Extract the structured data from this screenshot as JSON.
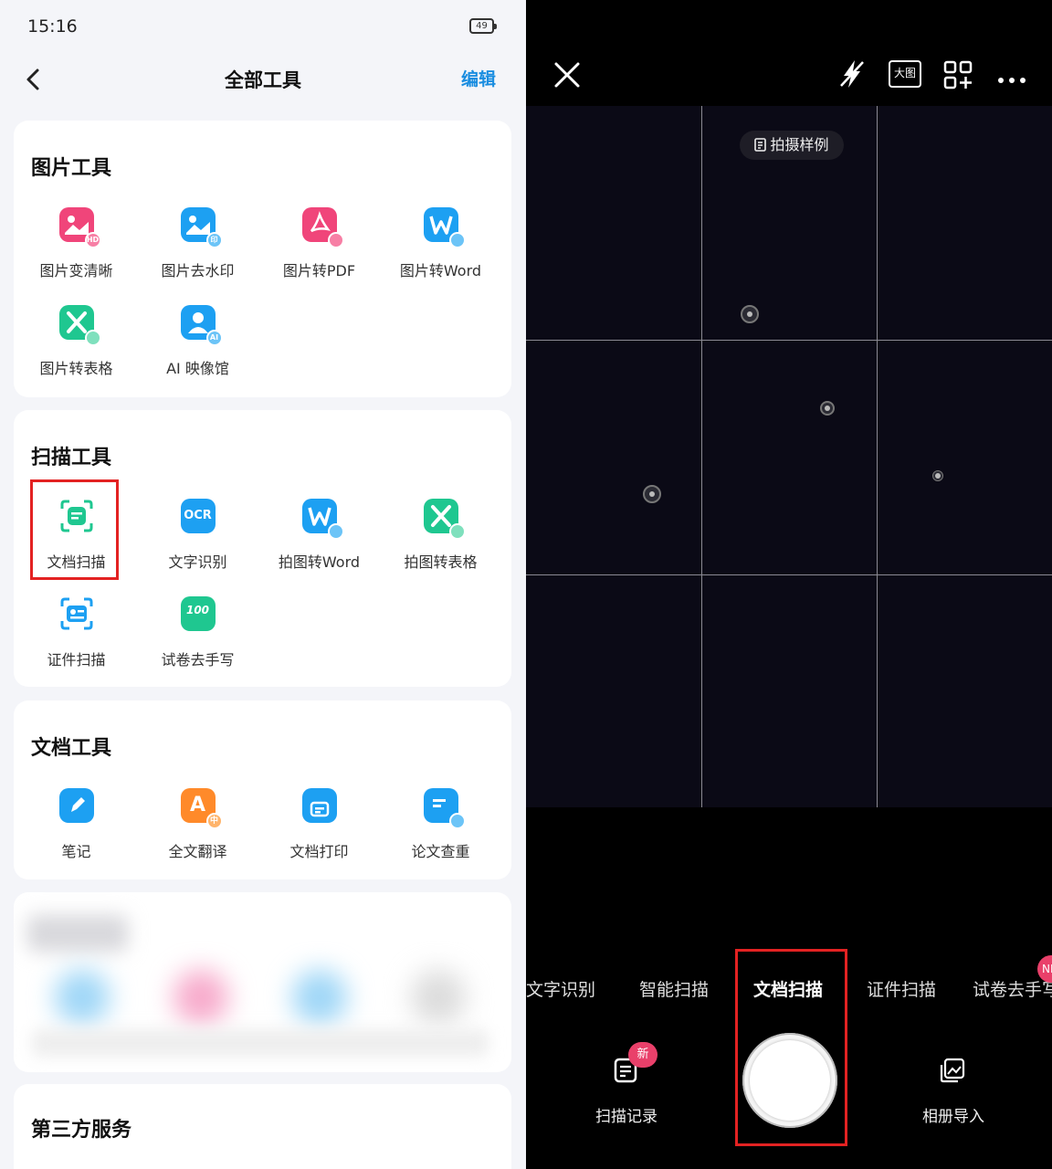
{
  "status_bar": {
    "time": "15:16",
    "battery": "49"
  },
  "nav": {
    "title": "全部工具",
    "edit": "编辑"
  },
  "sections": {
    "image_tools": {
      "title": "图片工具",
      "tools": [
        {
          "label": "图片变清晰",
          "icon": "image-hd-icon",
          "color": "#f0457a",
          "sub": "HD"
        },
        {
          "label": "图片去水印",
          "icon": "image-watermark-icon",
          "color": "#1da0f2",
          "sub": "印"
        },
        {
          "label": "图片转PDF",
          "icon": "image-pdf-icon",
          "color": "#f0457a",
          "sub": ""
        },
        {
          "label": "图片转Word",
          "icon": "image-word-icon",
          "color": "#1da0f2",
          "sub": ""
        },
        {
          "label": "图片转表格",
          "icon": "image-excel-icon",
          "color": "#1fc790",
          "sub": ""
        },
        {
          "label": "AI 映像馆",
          "icon": "ai-portrait-icon",
          "color": "#1da0f2",
          "sub": "AI"
        }
      ]
    },
    "scan_tools": {
      "title": "扫描工具",
      "tools": [
        {
          "label": "文档扫描",
          "icon": "document-scan-icon",
          "color": "#1fc790"
        },
        {
          "label": "文字识别",
          "icon": "ocr-icon",
          "color": "#1da0f2",
          "text": "OCR"
        },
        {
          "label": "拍图转Word",
          "icon": "photo-word-icon",
          "color": "#1da0f2"
        },
        {
          "label": "拍图转表格",
          "icon": "photo-excel-icon",
          "color": "#1fc790"
        },
        {
          "label": "证件扫描",
          "icon": "id-scan-icon",
          "color": "#1da0f2"
        },
        {
          "label": "试卷去手写",
          "icon": "exam-handwriting-icon",
          "color": "#1fc790",
          "text": "100"
        }
      ]
    },
    "doc_tools": {
      "title": "文档工具",
      "tools": [
        {
          "label": "笔记",
          "icon": "note-icon",
          "color": "#1da0f2"
        },
        {
          "label": "全文翻译",
          "icon": "translate-icon",
          "color": "#ff8a2a",
          "sub": "中"
        },
        {
          "label": "文档打印",
          "icon": "print-icon",
          "color": "#1da0f2"
        },
        {
          "label": "论文查重",
          "icon": "plagiarism-check-icon",
          "color": "#1da0f2"
        }
      ]
    },
    "third_party": {
      "title": "第三方服务"
    }
  },
  "camera": {
    "sample_label": "拍摄样例",
    "modes": [
      "文字识别",
      "智能扫描",
      "文档扫描",
      "证件扫描",
      "试卷去手写"
    ],
    "active_mode": "文档扫描",
    "new_mark": "NE",
    "scan_records": "扫描记录",
    "scan_records_badge": "新",
    "album_import": "相册导入",
    "big_image_label": "大图"
  },
  "colors": {
    "accent": "#1a8de0",
    "highlight": "#e32222",
    "badge": "#e9406a"
  }
}
